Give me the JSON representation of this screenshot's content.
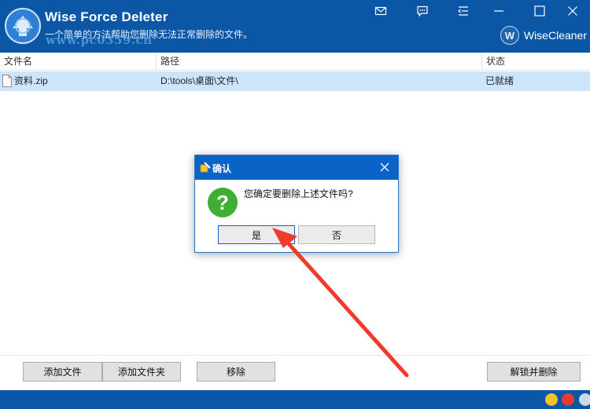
{
  "window": {
    "title": "Wise Force Deleter",
    "subtitle": "一个简单的方法帮助您删除无法正常删除的文件。",
    "watermark": "www.pc0359.cn",
    "brand": "WiseCleaner",
    "brand_mark": "W",
    "controls": [
      "mail-icon",
      "chat-icon",
      "menu-icon",
      "minimize-icon",
      "maximize-icon",
      "close-icon"
    ]
  },
  "table": {
    "columns": [
      "文件名",
      "路径",
      "状态"
    ],
    "rows": [
      {
        "name": "资料.zip",
        "path": "D:\\tools\\桌面\\文件\\",
        "status": "已就绪"
      }
    ]
  },
  "toolbar": {
    "add_file": "添加文件",
    "add_folder": "添加文件夹",
    "remove": "移除",
    "unlock_delete": "解锁并删除"
  },
  "dialog": {
    "title": "确认",
    "message": "您确定要删除上述文件吗?",
    "yes": "是",
    "no": "否",
    "icon": "question-icon",
    "icon_glyph": "?"
  },
  "colors": {
    "titlebar": "#0b57a6",
    "selected_row": "#cce5fb",
    "dialog_title": "#0a64c8",
    "question_icon": "#3fae33",
    "annotation_arrow": "#f03a2c"
  }
}
